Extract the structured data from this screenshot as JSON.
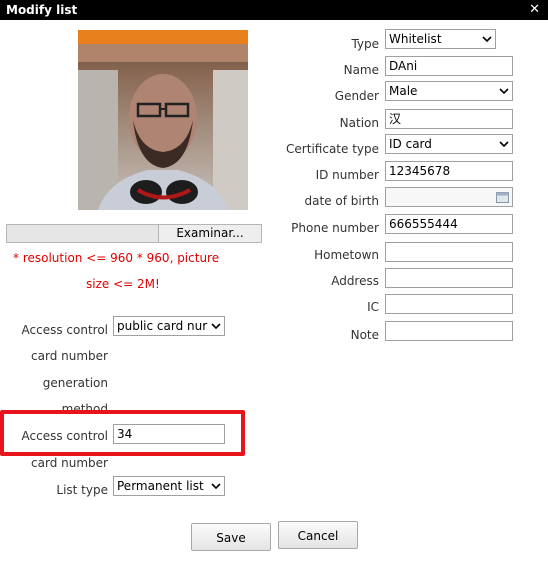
{
  "window": {
    "title": "Modify list",
    "close_glyph": "✕"
  },
  "photo": {
    "icon": "user-photo"
  },
  "upload": {
    "browse_label": "Examinar...",
    "warning_line1": "* resolution <= 960 * 960, picture",
    "warning_line2": "size <= 2M!"
  },
  "form": {
    "type": {
      "label": "Type",
      "value": "Whitelist"
    },
    "name": {
      "label": "Name",
      "value": "DAni"
    },
    "gender": {
      "label": "Gender",
      "value": "Male"
    },
    "nation": {
      "label": "Nation",
      "value": "汉"
    },
    "certificate_type": {
      "label": "Certificate type",
      "value": "ID card"
    },
    "id_number": {
      "label": "ID number",
      "value": "12345678"
    },
    "date_of_birth": {
      "label": "date of birth",
      "value": ""
    },
    "phone_number": {
      "label": "Phone number",
      "value": "666555444"
    },
    "hometown": {
      "label": "Hometown",
      "value": ""
    },
    "address": {
      "label": "Address",
      "value": ""
    },
    "ic": {
      "label": "IC",
      "value": ""
    },
    "note": {
      "label": "Note",
      "value": ""
    }
  },
  "left_form": {
    "access_method": {
      "label": "Access control",
      "value": "public card nur"
    },
    "method_label_1": "card number",
    "method_label_2": "generation",
    "method_label_3": "method",
    "access_card": {
      "label": "Access control",
      "value": "34"
    },
    "card_label_2": "card number",
    "list_type": {
      "label": "List type",
      "value": "Permanent list"
    }
  },
  "actions": {
    "save_label": "Save",
    "cancel_label": "Cancel"
  },
  "colors": {
    "highlight": "#e8141c",
    "warning": "#e00000",
    "titlebar": "#000000"
  }
}
